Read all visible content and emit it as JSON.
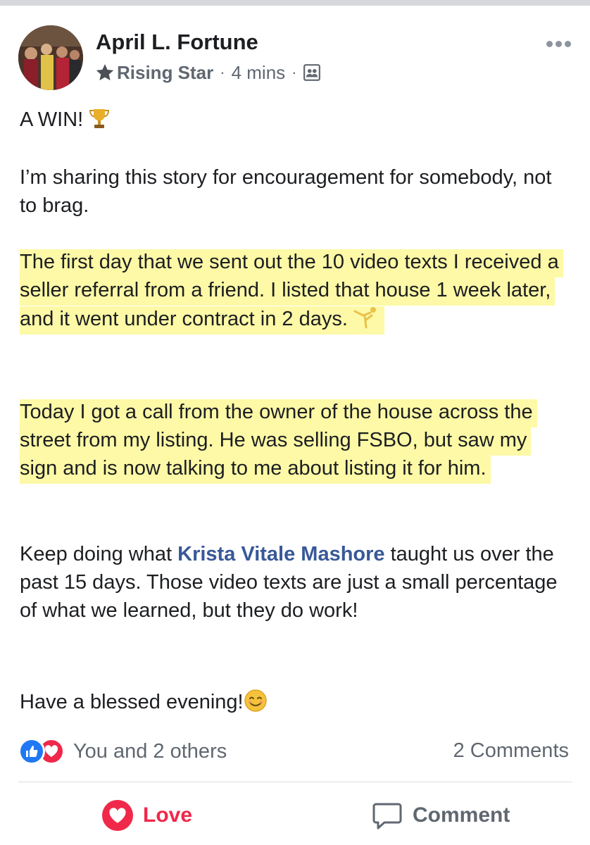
{
  "post": {
    "author": "April L. Fortune",
    "badge": "Rising Star",
    "time": "4 mins",
    "meta_separator": "·",
    "paragraphs": {
      "p1": "A WIN!",
      "p2": "I’m sharing this story for encouragement for somebody, not to brag.",
      "p3": "The first day that we sent out the 10 video texts I received a seller referral from a friend. I listed that house 1 week later, and it went under contract in 2 days.",
      "p4": "Today I got a call from the owner of the house across the street from my listing. He was selling FSBO, but saw my sign and is now talking to me about listing it for him.",
      "p5_before": "Keep doing what ",
      "p5_mention": "Krista Vitale Mashore",
      "p5_after": " taught us over the past 15 days. Those video texts are just a small percentage of what we learned, but they do work!",
      "p6": "Have a blessed evening!"
    },
    "highlight_color": "#fdf9a6",
    "mention_color": "#385898"
  },
  "footer": {
    "reactions_text": "You and 2 others",
    "comments_text": "2 Comments",
    "love_label": "Love",
    "comment_label": "Comment",
    "like_color": "#2078f4",
    "love_color": "#f0284a"
  },
  "icons": {
    "more": "more-options-icon",
    "badge": "star-icon",
    "group": "group-privacy-icon",
    "trophy": "trophy-emoji",
    "gymnast": "cartwheel-emoji",
    "smile": "smiling-face-emoji",
    "like": "thumbs-up-icon",
    "love": "heart-icon",
    "comment": "comment-bubble-icon"
  }
}
